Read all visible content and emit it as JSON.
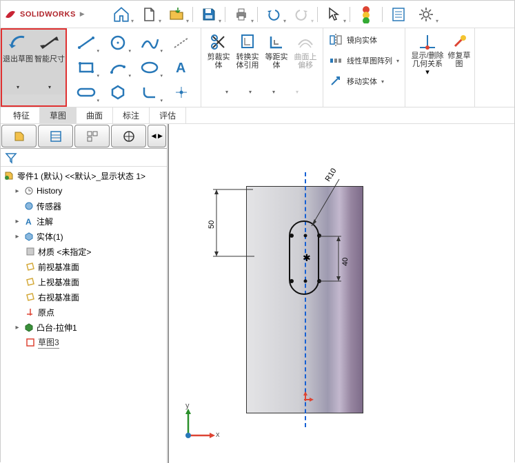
{
  "app": {
    "name": "SOLIDWORKS"
  },
  "toolbar": {
    "exit_sketch": "退出草图",
    "smart_dim": "智能尺寸",
    "trim": "剪裁实体",
    "convert": "转换实体引用",
    "offset": "等距实体",
    "onsurface": "曲面上偏移",
    "mirror": "镜向实体",
    "linear_pattern": "线性草图阵列",
    "move": "移动实体",
    "display_rel": "显示/删除几何关系",
    "repair": "修复草图"
  },
  "tabs": {
    "feature": "特征",
    "sketch": "草图",
    "surface": "曲面",
    "annotate": "标注",
    "evaluate": "评估"
  },
  "tree": {
    "root": "零件1 (默认) <<默认>_显示状态 1>",
    "history": "History",
    "sensors": "传感器",
    "annotations": "注解",
    "bodies": "实体(1)",
    "material": "材质 <未指定>",
    "front": "前视基准面",
    "top": "上视基准面",
    "right": "右视基准面",
    "origin": "原点",
    "extrude": "凸台-拉伸1",
    "sketch3": "草图3"
  },
  "dims": {
    "d50": "50",
    "d40": "40",
    "r10": "R10"
  },
  "axes": {
    "x": "x",
    "y": "y"
  },
  "chart_data": null
}
